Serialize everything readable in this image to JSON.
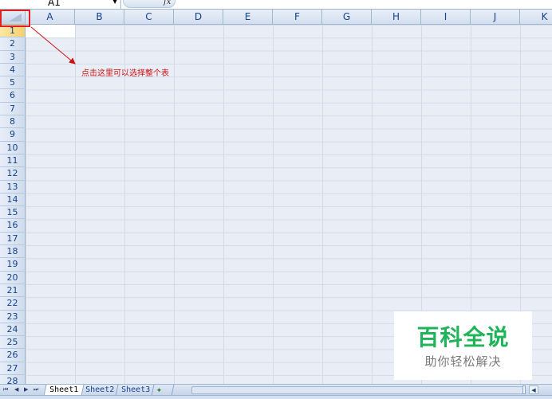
{
  "formula_bar": {
    "name_box_value": "A1",
    "fx_label": "fx"
  },
  "grid": {
    "columns": [
      "A",
      "B",
      "C",
      "D",
      "E",
      "F",
      "G",
      "H",
      "I",
      "J",
      "K"
    ],
    "rows": [
      "1",
      "2",
      "3",
      "4",
      "5",
      "6",
      "7",
      "8",
      "9",
      "10",
      "11",
      "12",
      "13",
      "14",
      "15",
      "16",
      "17",
      "18",
      "19",
      "20",
      "21",
      "22",
      "23",
      "24",
      "25",
      "26",
      "27",
      "28"
    ],
    "active_row": "1"
  },
  "annotation": {
    "text": "点击这里可以选择整个表",
    "color": "#cc1111"
  },
  "sheet_tabs": [
    "Sheet1",
    "Sheet2",
    "Sheet3"
  ],
  "active_sheet": "Sheet1",
  "tab_nav": {
    "first": "⏮",
    "prev": "◀",
    "next": "▶",
    "last": "⏭"
  },
  "watermark": {
    "title": "百科全说",
    "subtitle": "助你轻松解决",
    "color": "#1fb35a"
  },
  "colors": {
    "header_blue": "#15428b",
    "grid_line": "#d3dbe9",
    "highlight_red": "#e02020"
  }
}
